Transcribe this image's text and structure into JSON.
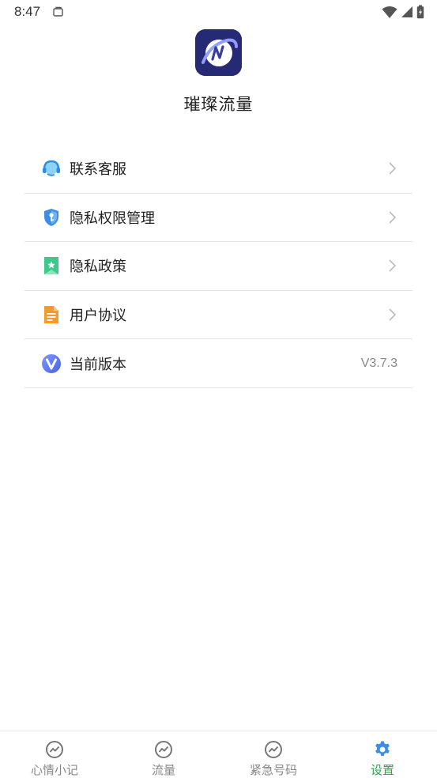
{
  "status_bar": {
    "time": "8:47"
  },
  "app": {
    "name": "璀璨流量",
    "logo_icon": "app-logo-icon"
  },
  "menu": {
    "items": [
      {
        "label": "联系客服",
        "icon": "customer-service-icon",
        "chevron": true
      },
      {
        "label": "隐私权限管理",
        "icon": "shield-key-icon",
        "chevron": true
      },
      {
        "label": "隐私政策",
        "icon": "bookmark-star-icon",
        "chevron": true
      },
      {
        "label": "用户协议",
        "icon": "document-icon",
        "chevron": true
      },
      {
        "label": "当前版本",
        "icon": "version-v-icon",
        "value": "V3.7.3"
      }
    ]
  },
  "bottom_nav": {
    "items": [
      {
        "label": "心情小记",
        "icon": "chart-circle-icon",
        "active": false
      },
      {
        "label": "流量",
        "icon": "chart-circle-icon",
        "active": false
      },
      {
        "label": "紧急号码",
        "icon": "chart-circle-icon",
        "active": false
      },
      {
        "label": "设置",
        "icon": "gear-icon",
        "active": true
      }
    ]
  },
  "colors": {
    "accent_green": "#2aa34a",
    "gear_blue": "#3a8ee6",
    "logo_bg": "#2a2f7d"
  }
}
